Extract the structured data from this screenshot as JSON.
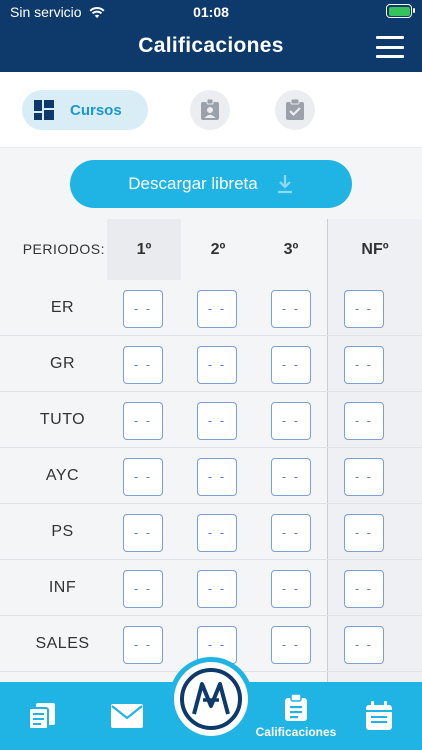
{
  "status_bar": {
    "carrier": "Sin servicio",
    "time": "01:08"
  },
  "header": {
    "title": "Calificaciones"
  },
  "tabs": {
    "active_label": "Cursos"
  },
  "download_button": {
    "label": "Descargar libreta"
  },
  "grades": {
    "periods_label": "PERIODOS:",
    "columns": [
      "1º",
      "2º",
      "3º",
      "NFº"
    ],
    "rows": [
      {
        "course": "ER",
        "values": [
          "- -",
          "- -",
          "- -",
          "- -"
        ]
      },
      {
        "course": "GR",
        "values": [
          "- -",
          "- -",
          "- -",
          "- -"
        ]
      },
      {
        "course": "TUTO",
        "values": [
          "- -",
          "- -",
          "- -",
          "- -"
        ]
      },
      {
        "course": "AYC",
        "values": [
          "- -",
          "- -",
          "- -",
          "- -"
        ]
      },
      {
        "course": "PS",
        "values": [
          "- -",
          "- -",
          "- -",
          "- -"
        ]
      },
      {
        "course": "INF",
        "values": [
          "- -",
          "- -",
          "- -",
          "- -"
        ]
      },
      {
        "course": "SALES",
        "values": [
          "- -",
          "- -",
          "- -",
          "- -"
        ]
      }
    ]
  },
  "bottom_nav": {
    "active_label": "Calificaciones"
  },
  "colors": {
    "header": "#0d3a6b",
    "accent": "#1fb4e4",
    "cell_border": "#7c9fd6"
  }
}
